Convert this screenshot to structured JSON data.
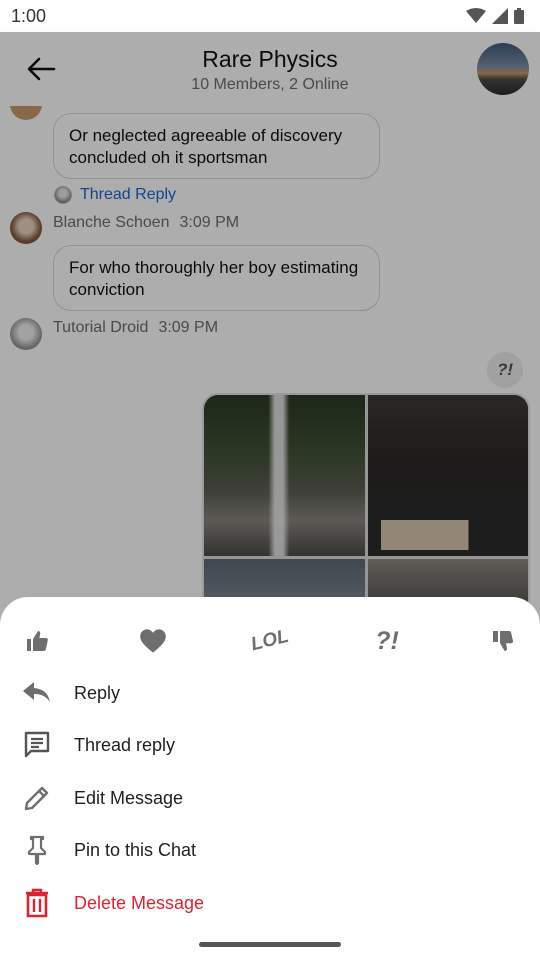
{
  "status_bar": {
    "time": "1:00"
  },
  "header": {
    "title": "Rare Physics",
    "subtitle": "10 Members, 2 Online"
  },
  "messages": [
    {
      "text": "Or neglected agreeable of discovery concluded oh it sportsman"
    },
    {
      "thread_reply": "Thread Reply"
    },
    {
      "author": "Blanche Schoen",
      "time": "3:09 PM",
      "text": "For who thoroughly her boy estimating conviction"
    },
    {
      "author": "Tutorial Droid",
      "time": "3:09 PM",
      "reaction": "?!"
    }
  ],
  "reaction_bar": [
    {
      "icon": "thumbs-up-icon"
    },
    {
      "icon": "heart-icon"
    },
    {
      "icon": "lol-icon",
      "label": "LOL"
    },
    {
      "icon": "exclamation-question-icon",
      "label": "?!"
    },
    {
      "icon": "thumbs-down-icon"
    }
  ],
  "actions": [
    {
      "label": "Reply",
      "icon": "reply-icon"
    },
    {
      "label": "Thread reply",
      "icon": "thread-icon"
    },
    {
      "label": "Edit Message",
      "icon": "pencil-icon"
    },
    {
      "label": "Pin to this Chat",
      "icon": "pin-icon"
    },
    {
      "label": "Delete Message",
      "icon": "trash-icon"
    }
  ],
  "colors": {
    "danger": "#e0212f",
    "link": "#1e63d6",
    "icon_gray": "#6e6e6e"
  }
}
